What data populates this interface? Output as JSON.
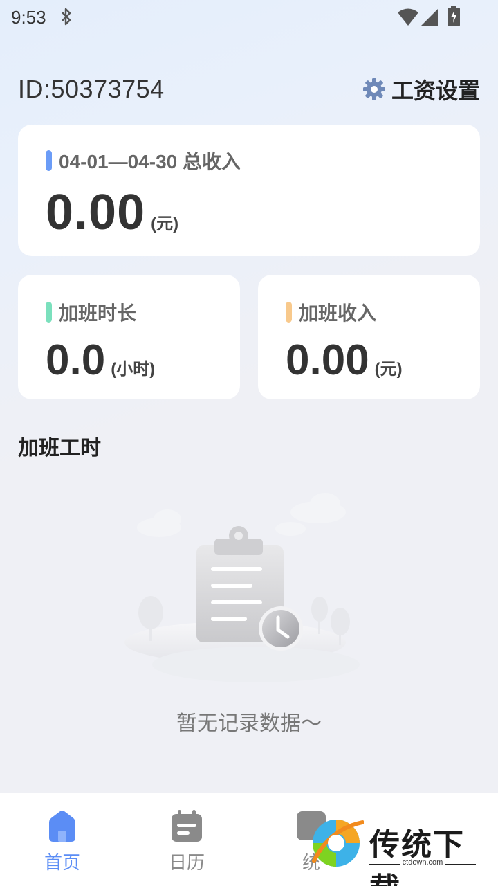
{
  "status_bar": {
    "time": "9:53"
  },
  "header": {
    "user_id": "ID:50373754",
    "settings_label": "工资设置"
  },
  "summary": {
    "period_title": "04-01—04-30 总收入",
    "total_amount": "0.00",
    "total_unit": "(元)"
  },
  "overtime_hours": {
    "title": "加班时长",
    "value": "0.0",
    "unit": "(小时)"
  },
  "overtime_income": {
    "title": "加班收入",
    "value": "0.00",
    "unit": "(元)"
  },
  "section": {
    "title": "加班工时"
  },
  "empty_state": {
    "text": "暂无记录数据～"
  },
  "nav": {
    "items": [
      {
        "label": "首页",
        "icon": "home-icon",
        "active": true
      },
      {
        "label": "日历",
        "icon": "calendar-icon",
        "active": false
      },
      {
        "label": "统",
        "icon": "stats-icon",
        "active": false
      }
    ]
  },
  "watermark": {
    "brand": "传统下载",
    "domain": "ctdown.com"
  },
  "colors": {
    "accent_blue": "#5b8df5",
    "mark_green": "#7be0bd",
    "mark_orange": "#f8c98c",
    "nav_inactive": "#8a8a8a"
  }
}
